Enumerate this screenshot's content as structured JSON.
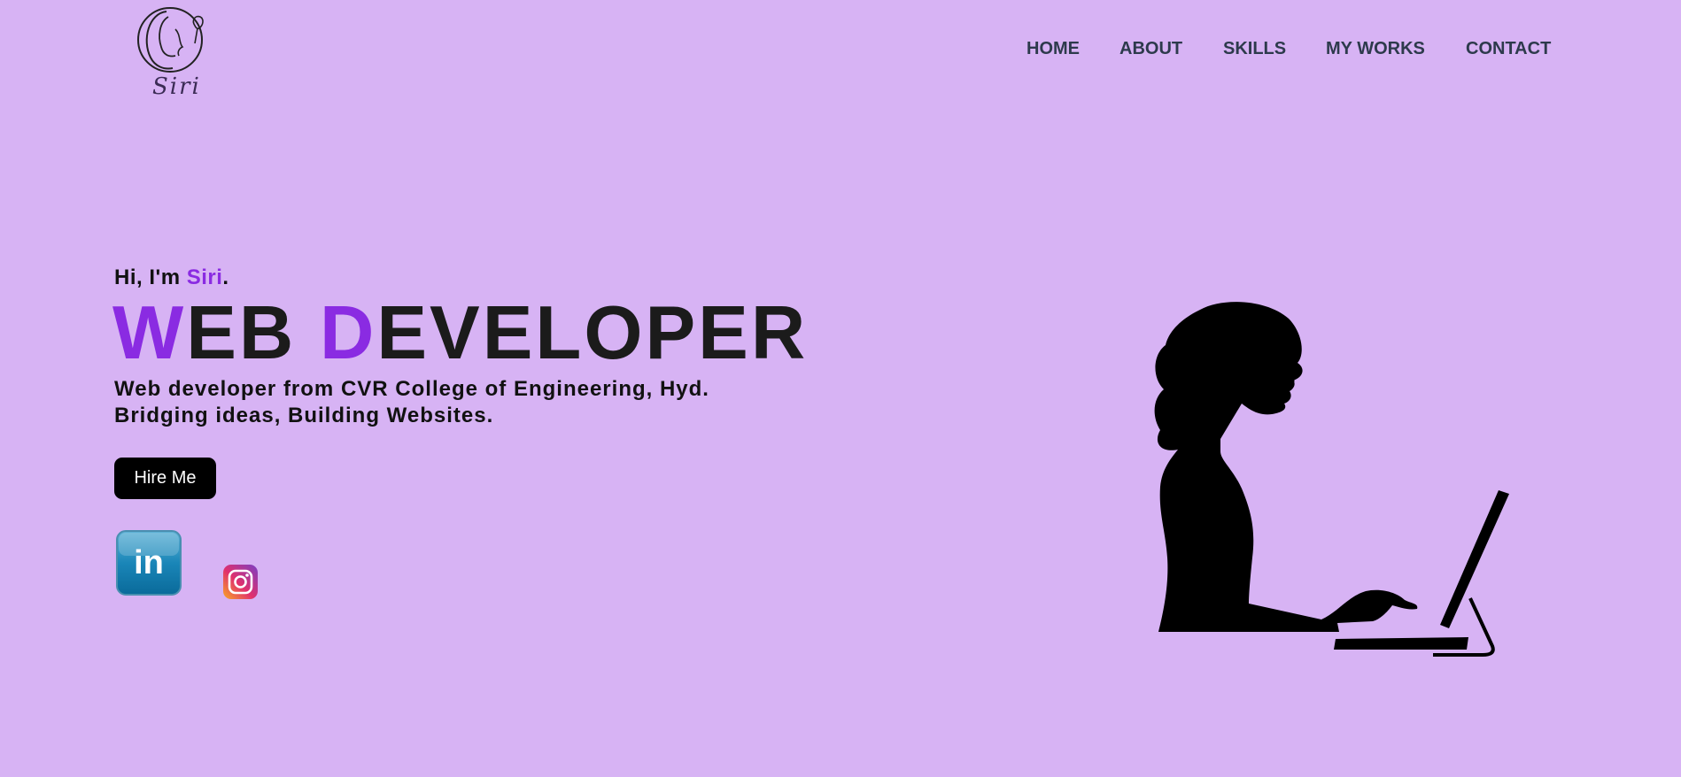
{
  "header": {
    "logo_text": "Siri",
    "nav": [
      "HOME",
      "ABOUT",
      "SKILLS",
      "MY WORKS",
      "CONTACT"
    ]
  },
  "hero": {
    "greeting_prefix": "Hi, I'm ",
    "greeting_name": "Siri",
    "greeting_suffix": ".",
    "title_w": "W",
    "title_eb": "EB ",
    "title_d": "D",
    "title_rest": "EVELOPER",
    "desc_line1": "Web developer from CVR College of Engineering, Hyd.",
    "desc_line2": "Bridging ideas, Building Websites.",
    "hire_label": "Hire Me"
  },
  "social": [
    {
      "name": "linkedin",
      "icon": "linkedin-icon",
      "glyph": "in"
    },
    {
      "name": "instagram",
      "icon": "instagram-icon"
    }
  ],
  "colors": {
    "background": "#d7b3f4",
    "accent": "#8a2be2",
    "nav_text": "#2d3a4c",
    "button": "#000000"
  },
  "illustration": "woman-at-computer-silhouette"
}
